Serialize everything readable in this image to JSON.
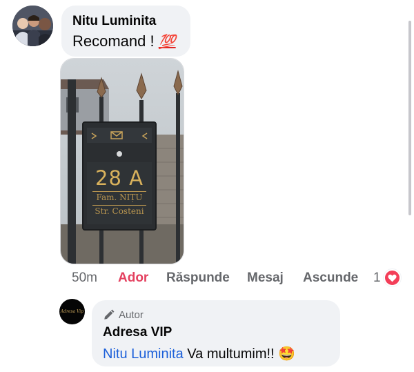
{
  "comment": {
    "author": "Nitu Luminita",
    "text": "Recomand !",
    "emoji": "💯",
    "photo_plate_number": "28 A",
    "photo_plate_line2": "Fam. NIȚU",
    "photo_plate_line3": "Str. Costeni"
  },
  "actions": {
    "time": "50m",
    "like": "Ador",
    "reply": "Răspunde",
    "message": "Mesaj",
    "hide": "Ascunde",
    "reaction_count": "1"
  },
  "reply": {
    "avatar_text": "Adresa Vip",
    "badge": "Autor",
    "author": "Adresa VIP",
    "mention": "Nitu Luminita",
    "text": "Va multumim!!",
    "emoji": "🤩"
  },
  "colors": {
    "like_active": "#e4405f",
    "mention": "#1b5fd9",
    "bubble": "#f0f2f5",
    "heart": "#f33e58"
  }
}
